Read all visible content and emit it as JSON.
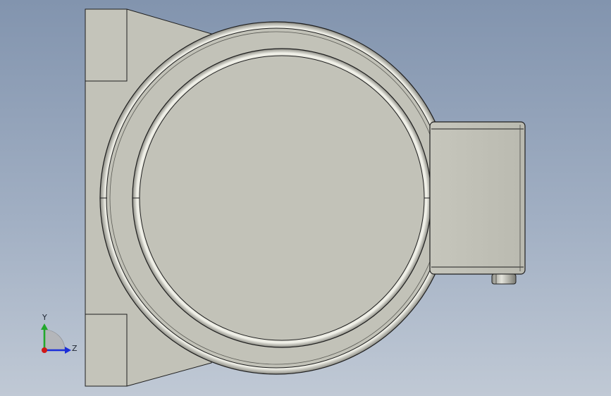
{
  "viewport": {
    "background_top": "#8294ae",
    "background_bottom": "#c0c9d5"
  },
  "model": {
    "part_color": "#c2c2b8",
    "edge_color": "#1e1e1e"
  },
  "triad": {
    "y_label": "Y",
    "z_label": "Z",
    "y_color": "#22a82c",
    "z_color": "#1b2ed8",
    "x_color": "#d01818"
  }
}
